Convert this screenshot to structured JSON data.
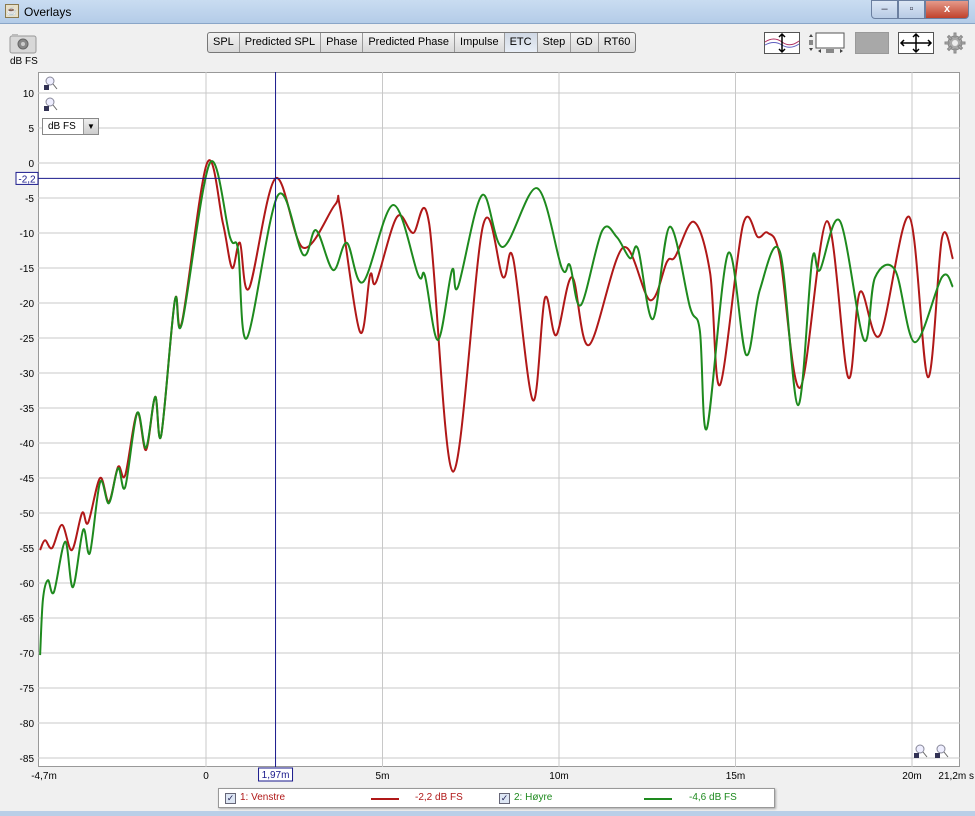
{
  "window": {
    "title": "Overlays",
    "minimize": "–",
    "maximize": "▫",
    "close": "x"
  },
  "toolbar": {
    "tabs": [
      "SPL",
      "Predicted SPL",
      "Phase",
      "Predicted Phase",
      "Impulse",
      "ETC",
      "Step",
      "GD",
      "RT60"
    ],
    "active": "ETC",
    "icons": [
      "camera-icon",
      "vertical-scale-icon",
      "fit-window-icon",
      "gray-panel-icon",
      "pan-arrows-icon",
      "gear-icon"
    ]
  },
  "y_unit_label": "dB FS",
  "unit_select": {
    "value": "dB FS"
  },
  "cursor": {
    "x_label": "1,97m",
    "y_label": "-2,2",
    "x": 1.97,
    "y": -2.2,
    "color": "#1a1a8c"
  },
  "legend": [
    {
      "label": "1: Venstre",
      "value": "-2,2 dB FS",
      "color": "#b01818",
      "checked": true
    },
    {
      "label": "2: Høyre",
      "value": "-4,6 dB FS",
      "color": "#1e8a1e",
      "checked": true
    }
  ],
  "chart_data": {
    "type": "line",
    "title": "ETC",
    "xlabel": "ms",
    "ylabel": "dB FS",
    "xlim": [
      -4.7,
      21.2
    ],
    "ylim": [
      -86,
      13
    ],
    "x_ticks": [
      {
        "v": -4.7,
        "label": "-4,7m"
      },
      {
        "v": 0,
        "label": "0"
      },
      {
        "v": 5,
        "label": "5m"
      },
      {
        "v": 10,
        "label": "10m"
      },
      {
        "v": 15,
        "label": "15m"
      },
      {
        "v": 20,
        "label": "20m"
      },
      {
        "v": 21.2,
        "label": "21,2m s"
      }
    ],
    "y_ticks": [
      10,
      5,
      0,
      -5,
      -10,
      -15,
      -20,
      -25,
      -30,
      -35,
      -40,
      -45,
      -50,
      -55,
      -60,
      -65,
      -70,
      -75,
      -80,
      -85
    ],
    "grid": true,
    "legend_position": "bottom",
    "series": [
      {
        "name": "1: Venstre",
        "color": "#b01818",
        "points": [
          [
            -4.7,
            -55.3
          ],
          [
            -4.56,
            -53.9
          ],
          [
            -4.36,
            -55
          ],
          [
            -4.08,
            -51.7
          ],
          [
            -3.8,
            -55.3
          ],
          [
            -3.51,
            -50
          ],
          [
            -3.34,
            -51.4
          ],
          [
            -3.0,
            -45
          ],
          [
            -2.75,
            -48.4
          ],
          [
            -2.49,
            -43.4
          ],
          [
            -2.29,
            -44.6
          ],
          [
            -1.95,
            -35.7
          ],
          [
            -1.7,
            -41
          ],
          [
            -1.44,
            -33.4
          ],
          [
            -1.27,
            -38.9
          ],
          [
            -0.88,
            -19.6
          ],
          [
            -0.68,
            -22.7
          ],
          [
            0.03,
            0
          ],
          [
            0.48,
            -8.6
          ],
          [
            0.74,
            -15
          ],
          [
            0.96,
            -11.4
          ],
          [
            1.22,
            -17.9
          ],
          [
            1.97,
            -2.2
          ],
          [
            2.75,
            -12.1
          ],
          [
            3.65,
            -6
          ],
          [
            3.8,
            -6.4
          ],
          [
            4.36,
            -24.1
          ],
          [
            4.65,
            -16
          ],
          [
            4.82,
            -17
          ],
          [
            5.41,
            -7.7
          ],
          [
            5.86,
            -10
          ],
          [
            6.32,
            -8.6
          ],
          [
            7.0,
            -44.1
          ],
          [
            7.85,
            -8.9
          ],
          [
            8.41,
            -16.3
          ],
          [
            8.7,
            -13.6
          ],
          [
            9.26,
            -33.9
          ],
          [
            9.6,
            -19.3
          ],
          [
            9.92,
            -24.6
          ],
          [
            10.37,
            -16.3
          ],
          [
            10.85,
            -26
          ],
          [
            11.81,
            -12.1
          ],
          [
            12.58,
            -19.6
          ],
          [
            13.06,
            -14.1
          ],
          [
            13.29,
            -13.4
          ],
          [
            13.82,
            -8.4
          ],
          [
            14.28,
            -15.7
          ],
          [
            14.56,
            -31.7
          ],
          [
            15.21,
            -8.9
          ],
          [
            15.64,
            -10.6
          ],
          [
            15.92,
            -10
          ],
          [
            16.26,
            -13.4
          ],
          [
            16.83,
            -32.1
          ],
          [
            17.59,
            -8.3
          ],
          [
            18.19,
            -30.6
          ],
          [
            18.53,
            -18.4
          ],
          [
            19.09,
            -24.6
          ],
          [
            19.92,
            -7.7
          ],
          [
            20.45,
            -30.6
          ],
          [
            20.85,
            -10.7
          ],
          [
            21.16,
            -13.7
          ]
        ]
      },
      {
        "name": "2: Høyre",
        "color": "#1e8a1e",
        "points": [
          [
            -4.7,
            -70.3
          ],
          [
            -4.62,
            -62.4
          ],
          [
            -4.48,
            -59.6
          ],
          [
            -4.31,
            -61.3
          ],
          [
            -3.99,
            -54.1
          ],
          [
            -3.77,
            -60.6
          ],
          [
            -3.48,
            -52.4
          ],
          [
            -3.29,
            -55.7
          ],
          [
            -3.0,
            -45.6
          ],
          [
            -2.75,
            -48.6
          ],
          [
            -2.49,
            -43.6
          ],
          [
            -2.29,
            -46.3
          ],
          [
            -1.95,
            -35.7
          ],
          [
            -1.7,
            -40.7
          ],
          [
            -1.44,
            -33.4
          ],
          [
            -1.27,
            -38.9
          ],
          [
            -0.88,
            -19.6
          ],
          [
            -0.68,
            -22.9
          ],
          [
            0.11,
            0
          ],
          [
            0.68,
            -10.6
          ],
          [
            0.91,
            -12.4
          ],
          [
            1.16,
            -25
          ],
          [
            2.04,
            -4.6
          ],
          [
            2.75,
            -13.1
          ],
          [
            3.12,
            -9.6
          ],
          [
            3.6,
            -15.3
          ],
          [
            3.99,
            -11.4
          ],
          [
            4.45,
            -17
          ],
          [
            5.3,
            -6
          ],
          [
            6.01,
            -16
          ],
          [
            6.2,
            -16.1
          ],
          [
            6.57,
            -25.3
          ],
          [
            6.97,
            -15.3
          ],
          [
            7.14,
            -17.7
          ],
          [
            7.82,
            -4.6
          ],
          [
            8.41,
            -12
          ],
          [
            9.38,
            -3.6
          ],
          [
            10.08,
            -15
          ],
          [
            10.31,
            -14.6
          ],
          [
            10.62,
            -20.3
          ],
          [
            11.22,
            -9.7
          ],
          [
            11.64,
            -10.6
          ],
          [
            12.01,
            -13.6
          ],
          [
            12.24,
            -12.3
          ],
          [
            12.66,
            -22.3
          ],
          [
            13.14,
            -9.1
          ],
          [
            13.71,
            -20.6
          ],
          [
            13.99,
            -23.9
          ],
          [
            14.19,
            -37.9
          ],
          [
            14.79,
            -12.9
          ],
          [
            15.3,
            -27.4
          ],
          [
            15.69,
            -18.1
          ],
          [
            16.26,
            -12.7
          ],
          [
            16.77,
            -34.6
          ],
          [
            17.17,
            -13.9
          ],
          [
            17.39,
            -15.3
          ],
          [
            17.96,
            -8.3
          ],
          [
            18.64,
            -25.3
          ],
          [
            18.95,
            -16.4
          ],
          [
            19.52,
            -15.3
          ],
          [
            20.08,
            -25.6
          ],
          [
            20.85,
            -16.3
          ],
          [
            21.16,
            -17.7
          ]
        ]
      }
    ]
  }
}
